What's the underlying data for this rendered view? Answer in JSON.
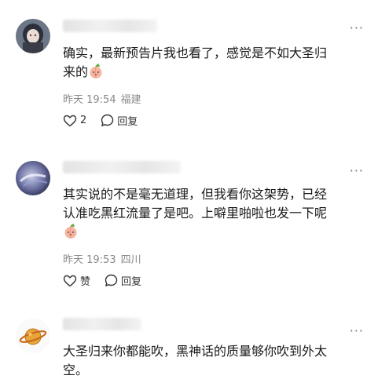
{
  "comments": [
    {
      "text_line1": "确实，最新预告片我也看了，感觉是不如大圣归",
      "text_line2": "来的",
      "time": "昨天 19:54",
      "location": "福建",
      "like_label": "2",
      "reply_label": "回复"
    },
    {
      "text_line1": "其实说的不是毫无道理，但我看你这架势，已经",
      "text_line2": "认准吃黑红流量了是吧。上噼里啪啦也发一下呢",
      "time": "昨天 19:53",
      "location": "四川",
      "like_label": "赞",
      "reply_label": "回复"
    },
    {
      "text_line1": "大圣归来你都能吹，黑神话的质量够你吹到外太",
      "text_line2": "空。"
    }
  ],
  "icons": {
    "like": "heart-outline-icon",
    "reply": "speech-bubble-icon",
    "more": "more-dots-icon",
    "emoji": "peach-face-emoji"
  },
  "colors": {
    "text": "#1a1a1a",
    "meta": "#8a8a8a",
    "background": "#ffffff"
  }
}
